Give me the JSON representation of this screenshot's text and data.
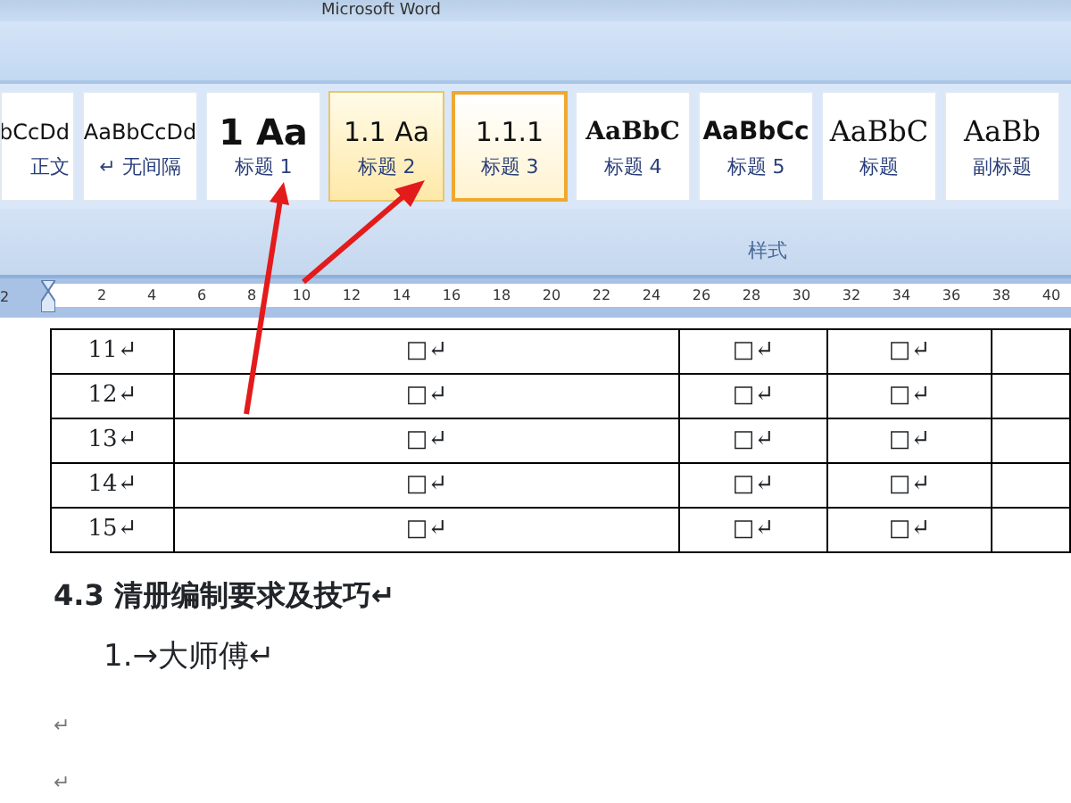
{
  "window": {
    "title": "Microsoft Word"
  },
  "styles_gallery": {
    "items": [
      {
        "preview": "bCcDd",
        "label": "正文",
        "kind": "body",
        "selected": false,
        "hovered": false
      },
      {
        "preview": "AaBbCcDd",
        "label": "↵ 无间隔",
        "kind": "body",
        "selected": false,
        "hovered": false
      },
      {
        "preview": "1  Aa",
        "label": "标题 1",
        "kind": "h1",
        "selected": false,
        "hovered": false
      },
      {
        "preview": "1.1  Aa",
        "label": "标题 2",
        "kind": "h2",
        "selected": false,
        "hovered": true
      },
      {
        "preview": "1.1.1",
        "label": "标题 3",
        "kind": "h3",
        "selected": true,
        "hovered": false
      },
      {
        "preview": "AaBbC",
        "label": "标题 4",
        "kind": "serifbold",
        "selected": false,
        "hovered": false
      },
      {
        "preview": "AaBbCc",
        "label": "标题 5",
        "kind": "sansbold",
        "selected": false,
        "hovered": false
      },
      {
        "preview": "AaBbC",
        "label": "标题",
        "kind": "title",
        "selected": false,
        "hovered": false
      },
      {
        "preview": "AaBb",
        "label": "副标题",
        "kind": "title",
        "selected": false,
        "hovered": false
      }
    ],
    "group_label": "样式"
  },
  "ruler": {
    "left_label": "2",
    "ticks": [
      "2",
      "4",
      "6",
      "8",
      "10",
      "12",
      "14",
      "16",
      "18",
      "20",
      "22",
      "24",
      "26",
      "28",
      "30",
      "32",
      "34",
      "36",
      "38",
      "40"
    ]
  },
  "table": {
    "rows": [
      [
        "11↵",
        "□↵",
        "□↵",
        "□↵"
      ],
      [
        "12↵",
        "□↵",
        "□↵",
        "□↵"
      ],
      [
        "13↵",
        "□↵",
        "□↵",
        "□↵"
      ],
      [
        "14↵",
        "□↵",
        "□↵",
        "□↵"
      ],
      [
        "15↵",
        "□↵",
        "□↵",
        "□↵"
      ]
    ]
  },
  "document": {
    "heading": "4.3 清册编制要求及技巧↵",
    "list_item": {
      "number": "1.→",
      "text": "大师傅↵"
    },
    "empty_paragraphs": [
      "↵",
      "↵"
    ]
  }
}
